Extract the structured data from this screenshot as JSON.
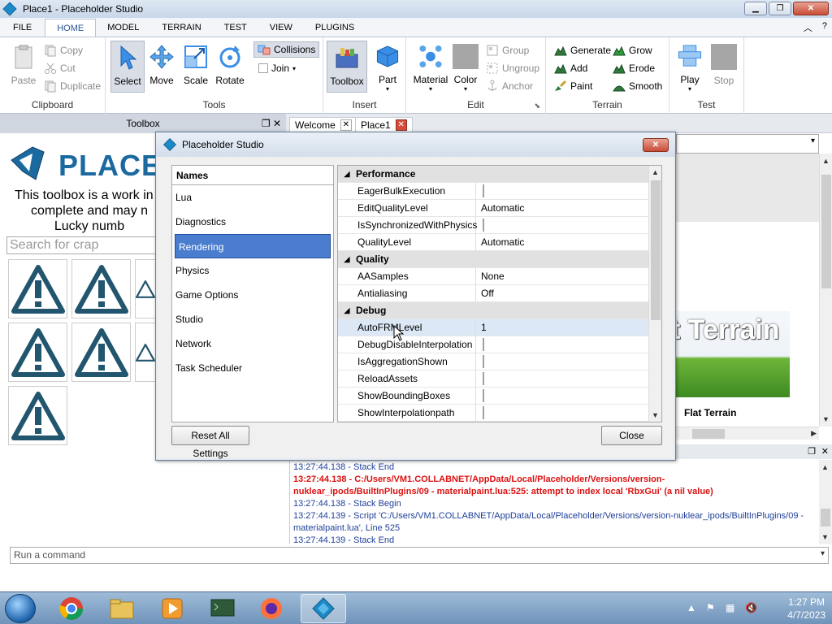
{
  "window": {
    "title": "Place1 - Placeholder Studio",
    "controls": {
      "minimize": "▁",
      "maximize": "❐",
      "close": "✕"
    }
  },
  "ribbon_tabs": [
    "FILE",
    "HOME",
    "MODEL",
    "TERRAIN",
    "TEST",
    "VIEW",
    "PLUGINS"
  ],
  "ribbon_active_tab": "HOME",
  "ribbon": {
    "clipboard": {
      "label": "Clipboard",
      "paste": "Paste",
      "copy": "Copy",
      "cut": "Cut",
      "duplicate": "Duplicate"
    },
    "tools": {
      "label": "Tools",
      "select": "Select",
      "move": "Move",
      "scale": "Scale",
      "rotate": "Rotate",
      "collisions": "Collisions",
      "join": "Join"
    },
    "insert": {
      "label": "Insert",
      "toolbox": "Toolbox",
      "part": "Part"
    },
    "edit": {
      "label": "Edit",
      "material": "Material",
      "color": "Color",
      "group": "Group",
      "ungroup": "Ungroup",
      "anchor": "Anchor"
    },
    "terrain": {
      "label": "Terrain",
      "generate": "Generate",
      "grow": "Grow",
      "add": "Add",
      "erode": "Erode",
      "paint": "Paint",
      "smooth": "Smooth"
    },
    "test": {
      "label": "Test",
      "play": "Play",
      "stop": "Stop"
    }
  },
  "dock": {
    "toolbox_tab": "Toolbox",
    "doc_tabs": [
      "Welcome",
      "Place1"
    ]
  },
  "toolbox": {
    "logo_text": "PLACE",
    "notice_lines": [
      "This toolbox is a work in p",
      "complete and may n",
      "Lucky numb"
    ],
    "search_placeholder": "Search for crap"
  },
  "right_panel": {
    "item_caption": "t Terrain",
    "item_label": "Flat Terrain"
  },
  "output": {
    "lines": [
      {
        "text": "13:27:44.138 - Stack End",
        "style": "blue"
      },
      {
        "text": "13:27:44.138 - C:/Users/VM1.COLLABNET/AppData/Local/Placeholder/Versions/version-",
        "style": "red"
      },
      {
        "text": "nuklear_ipods/BuiltInPlugins/09 - materialpaint.lua:525: attempt to index local 'RbxGui' (a nil value)",
        "style": "red"
      },
      {
        "text": "13:27:44.138 - Stack Begin",
        "style": "blue"
      },
      {
        "text": "13:27:44.139 - Script 'C:/Users/VM1.COLLABNET/AppData/Local/Placeholder/Versions/version-nuklear_ipods/BuiltInPlugins/09 -",
        "style": "blue"
      },
      {
        "text": "materialpaint.lua', Line 525",
        "style": "blue"
      },
      {
        "text": "13:27:44.139 - Stack End",
        "style": "blue"
      }
    ]
  },
  "command_bar": {
    "placeholder": "Run a command"
  },
  "dialog": {
    "title": "Placeholder Studio",
    "names_header": "Names",
    "names": [
      "Lua",
      "Diagnostics",
      "Rendering",
      "Physics",
      "Game Options",
      "Studio",
      "Network",
      "Task Scheduler"
    ],
    "selected_name": "Rendering",
    "properties": [
      {
        "type": "category",
        "name": "Performance"
      },
      {
        "type": "check",
        "name": "EagerBulkExecution",
        "checked": false
      },
      {
        "type": "value",
        "name": "EditQualityLevel",
        "value": "Automatic"
      },
      {
        "type": "check",
        "name": "IsSynchronizedWithPhysics",
        "checked": false
      },
      {
        "type": "value",
        "name": "QualityLevel",
        "value": "Automatic"
      },
      {
        "type": "category",
        "name": "Quality"
      },
      {
        "type": "value",
        "name": "AASamples",
        "value": "None"
      },
      {
        "type": "value",
        "name": "Antialiasing",
        "value": "Off"
      },
      {
        "type": "category",
        "name": "Debug"
      },
      {
        "type": "value",
        "name": "AutoFRMLevel",
        "value": "1",
        "highlight": true
      },
      {
        "type": "check",
        "name": "DebugDisableInterpolation",
        "checked": false
      },
      {
        "type": "check",
        "name": "IsAggregationShown",
        "checked": false
      },
      {
        "type": "check",
        "name": "ReloadAssets",
        "checked": false
      },
      {
        "type": "check",
        "name": "ShowBoundingBoxes",
        "checked": false
      },
      {
        "type": "check",
        "name": "ShowInterpolationpath",
        "checked": false
      }
    ],
    "reset_button": "Reset All Settings",
    "close_button": "Close"
  },
  "taskbar": {
    "time": "1:27 PM",
    "date": "4/7/2023"
  },
  "colors": {
    "accent": "#2b5797",
    "selection": "#4a7dce",
    "error_text": "#dd1111",
    "info_text": "#1f3f9a"
  }
}
